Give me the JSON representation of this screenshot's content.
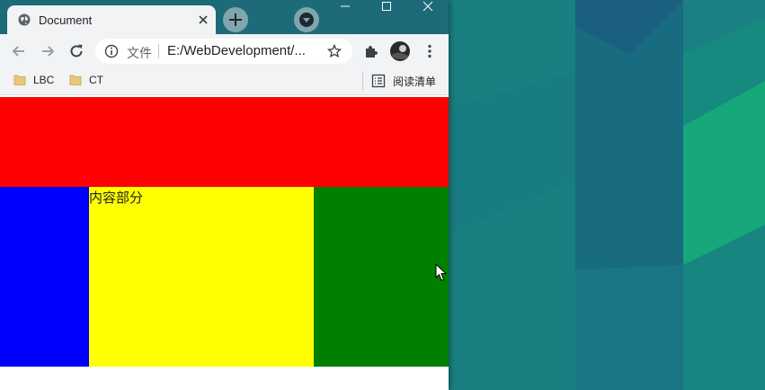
{
  "browser": {
    "tab_title": "Document",
    "address_label": "文件",
    "address_url": "E:/WebDevelopment/...",
    "bookmarks": [
      {
        "label": "LBC"
      },
      {
        "label": "CT"
      }
    ],
    "reading_list_label": "阅读清单"
  },
  "page": {
    "center_text": "内容部分"
  },
  "colors": {
    "header": "#ff0000",
    "left": "#0000ff",
    "center": "#ffff00",
    "right": "#008000",
    "titlebar": "#1d6a78",
    "wallpaper": "#1a7a7c"
  },
  "icons": [
    "globe-icon",
    "close-icon",
    "plus-icon",
    "profile-icon",
    "minimize-icon",
    "maximize-icon",
    "back-icon",
    "forward-icon",
    "reload-icon",
    "info-icon",
    "star-icon",
    "extensions-icon",
    "avatar",
    "menu-icon",
    "folder-icon",
    "reading-list-icon",
    "cursor-icon"
  ]
}
